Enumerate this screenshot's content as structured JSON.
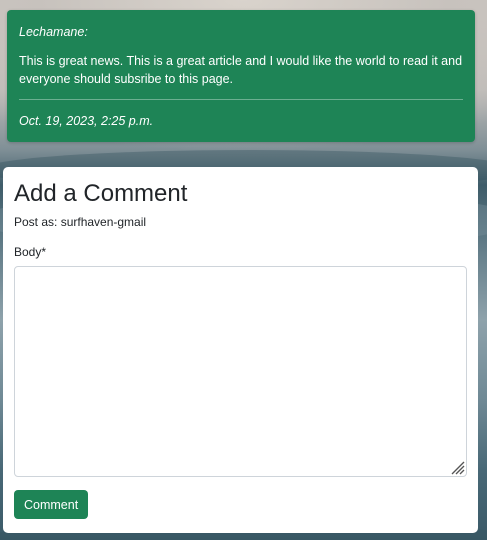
{
  "comment": {
    "author": "Lechamane:",
    "body": "This is great news. This is a great article and I would like the world to read it and everyone should subsribe to this page.",
    "date": "Oct. 19, 2023, 2:25 p.m."
  },
  "form": {
    "title": "Add a Comment",
    "post_as": "Post as: surfhaven-gmail",
    "body_label": "Body*",
    "body_value": "",
    "submit_label": "Comment"
  },
  "colors": {
    "accent": "#1e8456"
  },
  "icons": {
    "textarea_resize": "resize-grip-icon"
  }
}
